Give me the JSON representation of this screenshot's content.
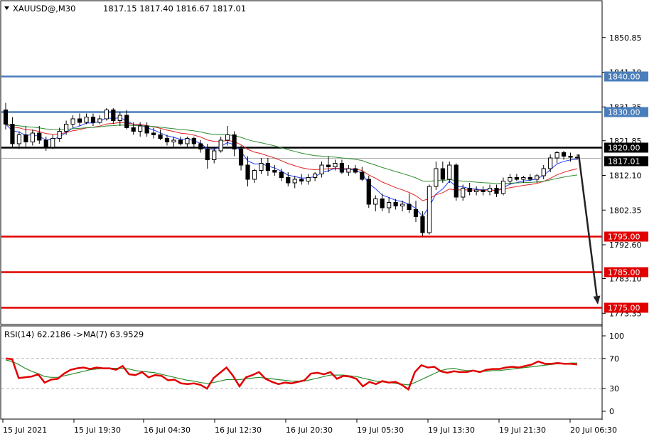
{
  "chart_data": [
    {
      "type": "candlestick",
      "symbol_header": "XAUUSD@,M30",
      "ohlc_header": "1817.15 1817.40 1816.67 1817.01",
      "y_range": [
        1771,
        1857
      ],
      "y_ticks": [
        "1850.85",
        "1841.10",
        "1831.35",
        "1821.85",
        "1812.10",
        "1802.35",
        "1792.60",
        "1783.10",
        "1773.35"
      ],
      "x_ticks": [
        "15 Jul 2021",
        "15 Jul 19:30",
        "16 Jul 04:30",
        "16 Jul 12:30",
        "16 Jul 20:30",
        "19 Jul 05:30",
        "19 Jul 13:30",
        "19 Jul 21:30",
        "20 Jul 06:30"
      ],
      "horizontal_levels": [
        {
          "label": "1840.00",
          "value": 1840.0,
          "color": "#4a7ebb"
        },
        {
          "label": "1830.00",
          "value": 1830.0,
          "color": "#4a7ebb"
        },
        {
          "label": "1820.00",
          "value": 1820.0,
          "color": "#000000"
        },
        {
          "label": "1795.00",
          "value": 1795.0,
          "color": "#e00000"
        },
        {
          "label": "1785.00",
          "value": 1785.0,
          "color": "#e00000"
        },
        {
          "label": "1775.00",
          "value": 1775.0,
          "color": "#e00000"
        }
      ],
      "current_price": {
        "label": "1817.01",
        "value": 1817.01
      },
      "forecast_arrow": {
        "from": 1818.0,
        "to": 1775.0
      },
      "candles": [
        {
          "o": 1830.5,
          "h": 1832.5,
          "l": 1825.0,
          "c": 1826.5
        },
        {
          "o": 1826.5,
          "h": 1828.5,
          "l": 1820.0,
          "c": 1821.0
        },
        {
          "o": 1821.0,
          "h": 1824.5,
          "l": 1819.5,
          "c": 1823.5
        },
        {
          "o": 1823.5,
          "h": 1826.0,
          "l": 1820.0,
          "c": 1821.5
        },
        {
          "o": 1821.5,
          "h": 1825.0,
          "l": 1820.5,
          "c": 1824.0
        },
        {
          "o": 1824.0,
          "h": 1826.0,
          "l": 1821.0,
          "c": 1822.0
        },
        {
          "o": 1822.0,
          "h": 1823.0,
          "l": 1819.0,
          "c": 1820.0
        },
        {
          "o": 1820.0,
          "h": 1823.5,
          "l": 1819.5,
          "c": 1822.5
        },
        {
          "o": 1822.5,
          "h": 1825.5,
          "l": 1821.5,
          "c": 1824.5
        },
        {
          "o": 1824.5,
          "h": 1827.5,
          "l": 1823.5,
          "c": 1826.5
        },
        {
          "o": 1826.5,
          "h": 1829.0,
          "l": 1825.5,
          "c": 1828.0
        },
        {
          "o": 1828.0,
          "h": 1829.5,
          "l": 1826.0,
          "c": 1827.0
        },
        {
          "o": 1827.0,
          "h": 1829.5,
          "l": 1826.5,
          "c": 1828.5
        },
        {
          "o": 1828.5,
          "h": 1829.5,
          "l": 1826.0,
          "c": 1827.0
        },
        {
          "o": 1827.0,
          "h": 1829.0,
          "l": 1826.5,
          "c": 1828.0
        },
        {
          "o": 1828.0,
          "h": 1831.0,
          "l": 1827.5,
          "c": 1830.5
        },
        {
          "o": 1830.5,
          "h": 1831.0,
          "l": 1826.5,
          "c": 1827.5
        },
        {
          "o": 1827.5,
          "h": 1830.0,
          "l": 1826.0,
          "c": 1829.0
        },
        {
          "o": 1829.0,
          "h": 1830.5,
          "l": 1825.0,
          "c": 1825.5
        },
        {
          "o": 1825.5,
          "h": 1827.0,
          "l": 1823.5,
          "c": 1824.5
        },
        {
          "o": 1824.5,
          "h": 1827.0,
          "l": 1823.0,
          "c": 1826.0
        },
        {
          "o": 1826.0,
          "h": 1827.0,
          "l": 1823.0,
          "c": 1824.0
        },
        {
          "o": 1824.0,
          "h": 1825.5,
          "l": 1822.5,
          "c": 1823.5
        },
        {
          "o": 1823.5,
          "h": 1825.0,
          "l": 1822.0,
          "c": 1822.5
        },
        {
          "o": 1822.5,
          "h": 1823.5,
          "l": 1820.5,
          "c": 1821.5
        },
        {
          "o": 1821.5,
          "h": 1823.0,
          "l": 1820.0,
          "c": 1822.0
        },
        {
          "o": 1822.0,
          "h": 1823.0,
          "l": 1820.5,
          "c": 1821.0
        },
        {
          "o": 1821.0,
          "h": 1823.0,
          "l": 1820.0,
          "c": 1822.5
        },
        {
          "o": 1822.5,
          "h": 1823.0,
          "l": 1820.0,
          "c": 1821.0
        },
        {
          "o": 1821.0,
          "h": 1822.0,
          "l": 1818.5,
          "c": 1819.5
        },
        {
          "o": 1819.5,
          "h": 1821.0,
          "l": 1814.0,
          "c": 1816.5
        },
        {
          "o": 1816.5,
          "h": 1820.0,
          "l": 1815.5,
          "c": 1819.0
        },
        {
          "o": 1819.0,
          "h": 1823.0,
          "l": 1818.5,
          "c": 1822.0
        },
        {
          "o": 1822.0,
          "h": 1826.0,
          "l": 1820.5,
          "c": 1823.5
        },
        {
          "o": 1823.5,
          "h": 1824.5,
          "l": 1817.5,
          "c": 1819.5
        },
        {
          "o": 1819.5,
          "h": 1820.5,
          "l": 1813.5,
          "c": 1815.0
        },
        {
          "o": 1815.0,
          "h": 1817.5,
          "l": 1809.0,
          "c": 1811.0
        },
        {
          "o": 1811.0,
          "h": 1814.0,
          "l": 1810.0,
          "c": 1813.5
        },
        {
          "o": 1813.5,
          "h": 1817.0,
          "l": 1812.5,
          "c": 1815.5
        },
        {
          "o": 1815.5,
          "h": 1817.0,
          "l": 1812.0,
          "c": 1813.5
        },
        {
          "o": 1813.5,
          "h": 1815.0,
          "l": 1812.0,
          "c": 1813.0
        },
        {
          "o": 1813.0,
          "h": 1814.0,
          "l": 1810.5,
          "c": 1811.5
        },
        {
          "o": 1811.5,
          "h": 1813.0,
          "l": 1809.0,
          "c": 1810.0
        },
        {
          "o": 1810.0,
          "h": 1812.0,
          "l": 1808.5,
          "c": 1811.0
        },
        {
          "o": 1811.0,
          "h": 1812.5,
          "l": 1809.5,
          "c": 1810.5
        },
        {
          "o": 1810.5,
          "h": 1812.5,
          "l": 1809.5,
          "c": 1811.5
        },
        {
          "o": 1811.5,
          "h": 1813.0,
          "l": 1810.5,
          "c": 1812.5
        },
        {
          "o": 1812.5,
          "h": 1816.0,
          "l": 1811.5,
          "c": 1815.0
        },
        {
          "o": 1815.0,
          "h": 1817.5,
          "l": 1813.0,
          "c": 1814.5
        },
        {
          "o": 1814.5,
          "h": 1816.5,
          "l": 1813.5,
          "c": 1815.5
        },
        {
          "o": 1815.5,
          "h": 1816.5,
          "l": 1812.5,
          "c": 1813.0
        },
        {
          "o": 1813.0,
          "h": 1815.0,
          "l": 1812.0,
          "c": 1814.0
        },
        {
          "o": 1814.0,
          "h": 1815.0,
          "l": 1812.5,
          "c": 1813.0
        },
        {
          "o": 1813.0,
          "h": 1814.5,
          "l": 1810.5,
          "c": 1811.0
        },
        {
          "o": 1811.0,
          "h": 1812.0,
          "l": 1803.0,
          "c": 1804.0
        },
        {
          "o": 1804.0,
          "h": 1806.5,
          "l": 1802.0,
          "c": 1805.5
        },
        {
          "o": 1805.5,
          "h": 1807.0,
          "l": 1802.0,
          "c": 1803.0
        },
        {
          "o": 1803.0,
          "h": 1806.0,
          "l": 1801.5,
          "c": 1804.5
        },
        {
          "o": 1804.5,
          "h": 1805.5,
          "l": 1802.5,
          "c": 1803.5
        },
        {
          "o": 1803.5,
          "h": 1805.0,
          "l": 1802.0,
          "c": 1804.0
        },
        {
          "o": 1804.0,
          "h": 1807.0,
          "l": 1801.5,
          "c": 1802.5
        },
        {
          "o": 1802.5,
          "h": 1805.0,
          "l": 1799.0,
          "c": 1800.5
        },
        {
          "o": 1800.5,
          "h": 1802.0,
          "l": 1795.0,
          "c": 1796.0
        },
        {
          "o": 1796.0,
          "h": 1809.5,
          "l": 1795.5,
          "c": 1809.0
        },
        {
          "o": 1809.0,
          "h": 1816.0,
          "l": 1808.0,
          "c": 1814.0
        },
        {
          "o": 1814.0,
          "h": 1816.0,
          "l": 1810.0,
          "c": 1811.0
        },
        {
          "o": 1811.0,
          "h": 1816.0,
          "l": 1810.0,
          "c": 1815.0
        },
        {
          "o": 1815.0,
          "h": 1815.5,
          "l": 1805.0,
          "c": 1806.0
        },
        {
          "o": 1806.0,
          "h": 1809.5,
          "l": 1805.0,
          "c": 1808.5
        },
        {
          "o": 1808.5,
          "h": 1810.0,
          "l": 1806.5,
          "c": 1807.5
        },
        {
          "o": 1807.5,
          "h": 1809.0,
          "l": 1806.5,
          "c": 1808.0
        },
        {
          "o": 1808.0,
          "h": 1809.0,
          "l": 1806.5,
          "c": 1807.5
        },
        {
          "o": 1807.5,
          "h": 1809.5,
          "l": 1806.5,
          "c": 1808.5
        },
        {
          "o": 1808.5,
          "h": 1809.5,
          "l": 1806.0,
          "c": 1807.0
        },
        {
          "o": 1807.0,
          "h": 1811.5,
          "l": 1806.5,
          "c": 1810.5
        },
        {
          "o": 1810.5,
          "h": 1812.5,
          "l": 1809.5,
          "c": 1811.5
        },
        {
          "o": 1811.5,
          "h": 1812.5,
          "l": 1810.5,
          "c": 1811.0
        },
        {
          "o": 1811.0,
          "h": 1812.0,
          "l": 1810.0,
          "c": 1811.5
        },
        {
          "o": 1811.5,
          "h": 1812.5,
          "l": 1810.5,
          "c": 1811.0
        },
        {
          "o": 1811.0,
          "h": 1812.5,
          "l": 1810.0,
          "c": 1812.0
        },
        {
          "o": 1812.0,
          "h": 1815.0,
          "l": 1811.0,
          "c": 1814.0
        },
        {
          "o": 1814.0,
          "h": 1818.0,
          "l": 1813.0,
          "c": 1817.0
        },
        {
          "o": 1817.0,
          "h": 1819.0,
          "l": 1815.5,
          "c": 1818.5
        },
        {
          "o": 1818.5,
          "h": 1819.0,
          "l": 1816.5,
          "c": 1817.5
        },
        {
          "o": 1817.5,
          "h": 1818.5,
          "l": 1816.0,
          "c": 1817.2
        },
        {
          "o": 1817.2,
          "h": 1818.0,
          "l": 1816.5,
          "c": 1817.0
        }
      ],
      "moving_averages": [
        {
          "period": 5,
          "color": "#1f3fff"
        },
        {
          "period": 14,
          "color": "#e02020"
        },
        {
          "period": 34,
          "color": "#2e8b2e"
        }
      ]
    },
    {
      "type": "line",
      "indicator_header": "RSI(14) 62.2186  ->MA(7) 63.9529",
      "y_range": [
        0,
        100
      ],
      "y_ticks": [
        "100",
        "70",
        "30",
        "0"
      ],
      "levels": [
        70,
        30
      ],
      "series": [
        {
          "name": "RSI(14)",
          "color": "#e00000",
          "values": [
            70,
            69,
            44,
            45,
            46,
            49,
            38,
            42,
            43,
            50,
            55,
            57,
            58,
            56,
            58,
            57,
            57,
            55,
            60,
            49,
            48,
            52,
            45,
            48,
            47,
            41,
            42,
            37,
            36,
            37,
            35,
            30,
            44,
            51,
            58,
            47,
            33,
            45,
            48,
            52,
            43,
            39,
            36,
            38,
            37,
            39,
            41,
            50,
            51,
            49,
            52,
            43,
            47,
            46,
            43,
            33,
            39,
            36,
            40,
            38,
            39,
            35,
            29,
            52,
            61,
            58,
            59,
            53,
            51,
            53,
            52,
            52,
            54,
            52,
            55,
            56,
            56,
            58,
            59,
            58,
            60,
            62,
            66,
            63,
            63,
            64,
            63,
            63,
            62
          ]
        },
        {
          "name": "MA(7)",
          "color": "#2e8b2e",
          "values": [
            68,
            66,
            62,
            57,
            53,
            50,
            46,
            45,
            45,
            47,
            49,
            51,
            53,
            55,
            56,
            57,
            57,
            57,
            57,
            56,
            54,
            53,
            52,
            51,
            49,
            47,
            45,
            43,
            41,
            40,
            38,
            37,
            38,
            40,
            42,
            42,
            42,
            43,
            44,
            45,
            44,
            43,
            42,
            41,
            40,
            40,
            40,
            42,
            44,
            46,
            48,
            48,
            48,
            47,
            46,
            44,
            42,
            40,
            39,
            38,
            37,
            36,
            35,
            38,
            42,
            46,
            50,
            54,
            56,
            57,
            55,
            54,
            54,
            53,
            53,
            54,
            54,
            55,
            56,
            57,
            58,
            59,
            60,
            61,
            62,
            63,
            63,
            64,
            64
          ]
        }
      ]
    }
  ]
}
